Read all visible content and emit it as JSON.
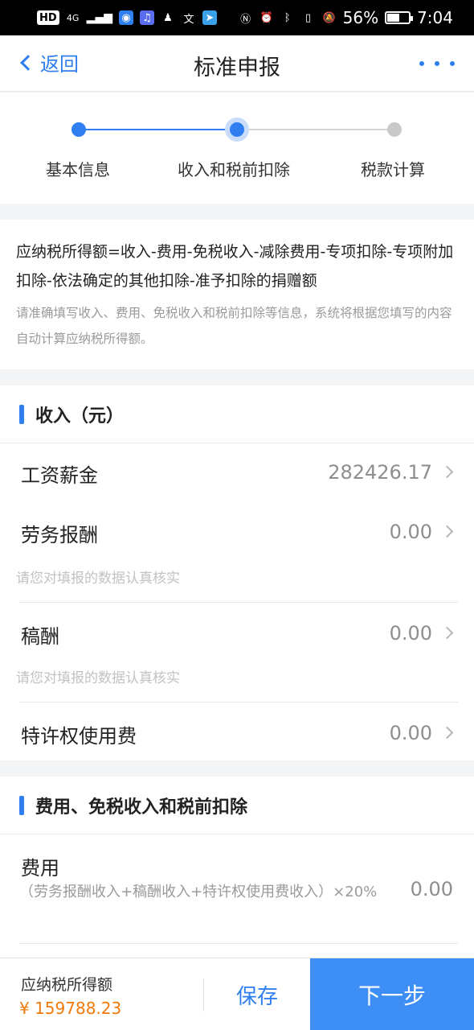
{
  "status_bar": {
    "left_badges": [
      "HD",
      "4G"
    ],
    "battery_percent": "56%",
    "battery_level": 0.56,
    "time": "7:04"
  },
  "nav": {
    "back_label": "返回",
    "title": "标准申报",
    "more_icon": "more-dots-icon"
  },
  "steps": {
    "items": [
      {
        "label": "基本信息",
        "state": "done"
      },
      {
        "label": "收入和税前扣除",
        "state": "current"
      },
      {
        "label": "税款计算",
        "state": "pending"
      }
    ],
    "colors": {
      "active": "#2f7ff0",
      "inactive": "#c9c9c9"
    }
  },
  "formula": {
    "main": "应纳税所得额=收入-费用-免税收入-减除费用-专项扣除-专项附加扣除-依法确定的其他扣除-准予扣除的捐赠额",
    "hint": "请准确填写收入、费用、免税收入和税前扣除等信息，系统将根据您填写的内容自动计算应纳税所得额。"
  },
  "income": {
    "title": "收入（元）",
    "rows": [
      {
        "label": "工资薪金",
        "value": "282426.17",
        "hint": ""
      },
      {
        "label": "劳务报酬",
        "value": "0.00",
        "hint": "请您对填报的数据认真核实"
      },
      {
        "label": "稿酬",
        "value": "0.00",
        "hint": "请您对填报的数据认真核实"
      },
      {
        "label": "特许权使用费",
        "value": "0.00",
        "hint": ""
      }
    ]
  },
  "deductions": {
    "title": "费用、免税收入和税前扣除",
    "fee": {
      "label": "费用",
      "formula": "（劳务报酬收入+稿酬收入+特许权使用费收入）×20%",
      "value": "0.00"
    }
  },
  "footer": {
    "taxable_label": "应纳税所得额",
    "taxable_amount": "¥ 159788.23",
    "save_label": "保存",
    "next_label": "下一步"
  },
  "colors": {
    "accent": "#2f7ff0",
    "amount": "#f07a0a",
    "next_button": "#3d8ef5"
  }
}
